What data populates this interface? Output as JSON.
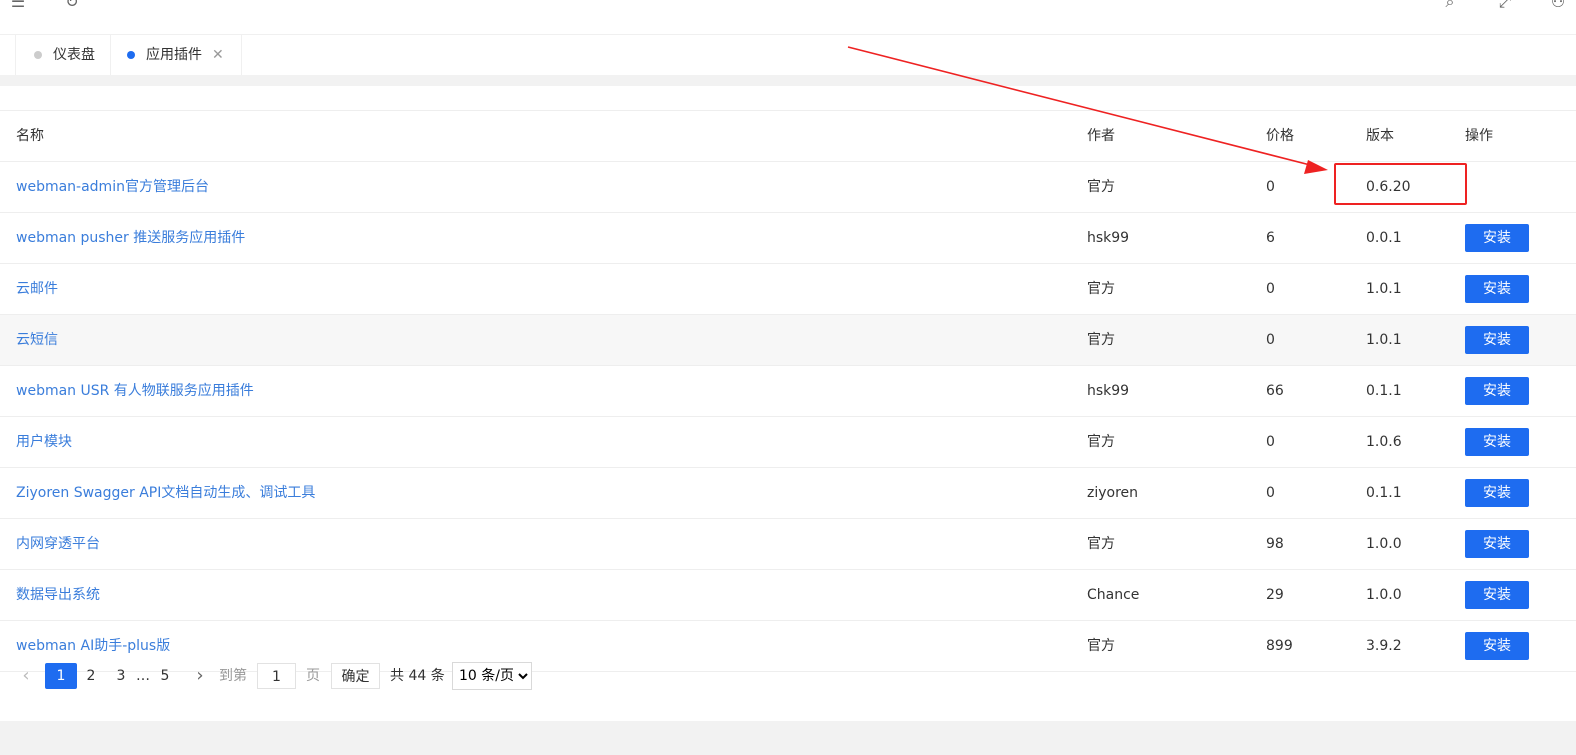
{
  "topbar": {
    "menu_icon": "menu-icon",
    "refresh_icon": "refresh-icon",
    "search_icon": "search-icon",
    "fullscreen_icon": "fullscreen-icon",
    "user_icon": "user-icon"
  },
  "tabs": [
    {
      "label": "仪表盘",
      "active": false
    },
    {
      "label": "应用插件",
      "active": true,
      "close": "✕"
    }
  ],
  "table": {
    "columns": [
      "名称",
      "作者",
      "价格",
      "版本",
      "操作"
    ],
    "rows": [
      {
        "name": "webman-admin官方管理后台",
        "author": "官方",
        "price": "0",
        "version": "0.6.20",
        "action": ""
      },
      {
        "name": "webman pusher 推送服务应用插件",
        "author": "hsk99",
        "price": "6",
        "version": "0.0.1",
        "action": "安装"
      },
      {
        "name": "云邮件",
        "author": "官方",
        "price": "0",
        "version": "1.0.1",
        "action": "安装"
      },
      {
        "name": "云短信",
        "author": "官方",
        "price": "0",
        "version": "1.0.1",
        "action": "安装"
      },
      {
        "name": "webman USR 有人物联服务应用插件",
        "author": "hsk99",
        "price": "66",
        "version": "0.1.1",
        "action": "安装"
      },
      {
        "name": "用户模块",
        "author": "官方",
        "price": "0",
        "version": "1.0.6",
        "action": "安装"
      },
      {
        "name": "Ziyoren Swagger API文档自动生成、调试工具",
        "author": "ziyoren",
        "price": "0",
        "version": "0.1.1",
        "action": "安装"
      },
      {
        "name": "内网穿透平台",
        "author": "官方",
        "price": "98",
        "version": "1.0.0",
        "action": "安装"
      },
      {
        "name": "数据导出系统",
        "author": "Chance",
        "price": "29",
        "version": "1.0.0",
        "action": "安装"
      },
      {
        "name": "webman AI助手-plus版",
        "author": "官方",
        "price": "899",
        "version": "3.9.2",
        "action": "安装"
      }
    ]
  },
  "pager": {
    "prev": "‹",
    "next": "›",
    "pages": [
      "1",
      "2",
      "3",
      "…",
      "5"
    ],
    "current": "1",
    "goto_label": "到第",
    "goto_value": "1",
    "page_unit": "页",
    "confirm": "确定",
    "total": "共 44 条",
    "page_size": "10 条/页"
  },
  "colors": {
    "accent": "#1e6cf0",
    "link": "#3a7ddb",
    "annotation": "#ee2222"
  }
}
